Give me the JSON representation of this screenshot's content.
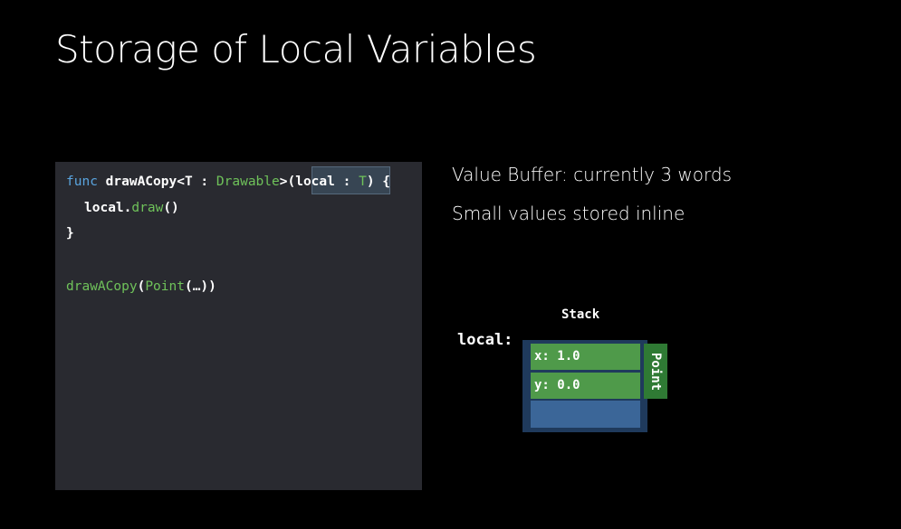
{
  "slide": {
    "title": "Storage of Local Variables"
  },
  "code": {
    "line1": {
      "kw_func": "func",
      "fn_name": "drawACopy",
      "lt": "<",
      "generic_param": "T",
      "colon1": " : ",
      "protocol": "Drawable",
      "gt_paren": ">(",
      "param_name": "local",
      "colon2": " : ",
      "param_type": "T",
      "close": ") {"
    },
    "line2": {
      "receiver": "local",
      "dot": ".",
      "method": "draw",
      "parens": "()"
    },
    "line3": "}",
    "line4": {
      "call_name": "drawACopy",
      "open": "(",
      "arg_type": "Point",
      "args": "(…))"
    }
  },
  "bullets": [
    "Value Buffer: currently 3 words",
    "Small values stored inline"
  ],
  "diagram": {
    "stack_label": "Stack",
    "local_label": "local:",
    "cells": [
      "x: 1.0",
      "y: 0.0"
    ],
    "type_tag": "Point"
  },
  "colors": {
    "background": "#000000",
    "code_panel": "#292a30",
    "keyword": "#5aa5e0",
    "type_green": "#6fc25a",
    "cell_green": "#4f9a4a",
    "buffer_blue": "#3b6698"
  }
}
